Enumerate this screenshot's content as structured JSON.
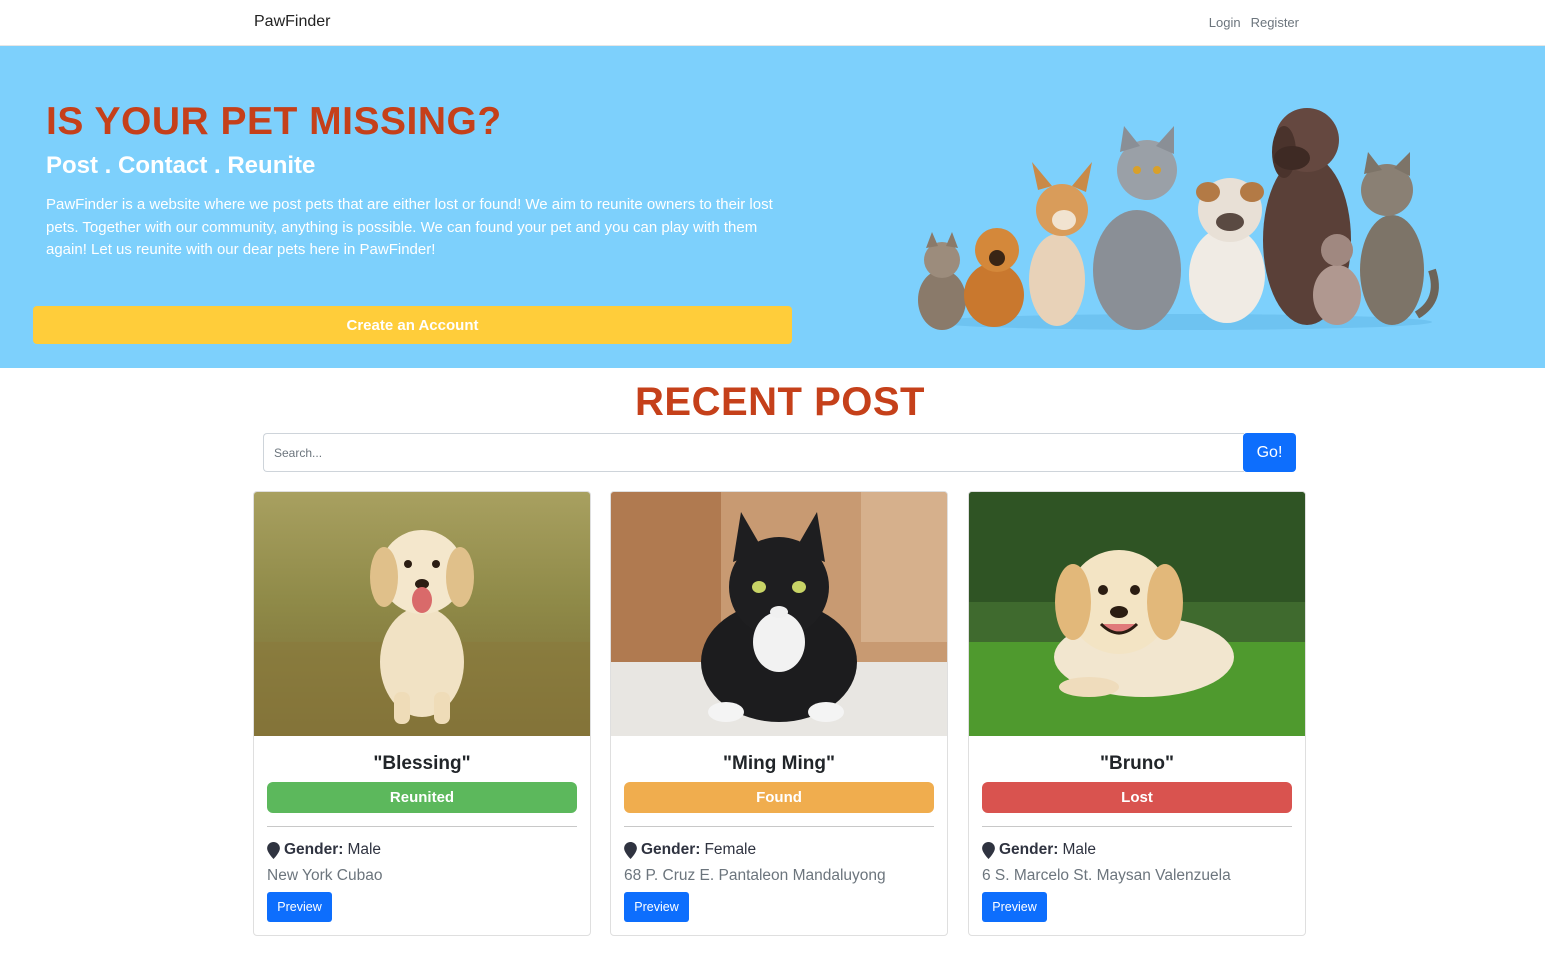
{
  "navbar": {
    "brand": "PawFinder",
    "links": [
      {
        "label": "Login"
      },
      {
        "label": "Register"
      }
    ]
  },
  "hero": {
    "title": "IS YOUR PET MISSING?",
    "subtitle": "Post . Contact . Reunite",
    "description": "PawFinder is a website where we post pets that are either lost or found! We aim to reunite owners to their lost pets. Together with our community, anything is possible. We can found your pet and you can play with them again! Let us reunite with our dear pets here in PawFinder!",
    "cta_label": "Create an Account"
  },
  "recent": {
    "title": "RECENT POST",
    "search_placeholder": "Search...",
    "search_button": "Go!"
  },
  "colors": {
    "hero_bg": "#7dd0fc",
    "accent_title": "#c5401a",
    "cta": "#ffcd3a",
    "primary": "#0d6efd",
    "reunited": "#5cb85c",
    "found": "#f0ad4e",
    "lost": "#d9534f"
  },
  "posts": [
    {
      "name": "\"Blessing\"",
      "status": "Reunited",
      "gender_label": "Gender:",
      "gender": "Male",
      "location": "New York Cubao",
      "preview": "Preview",
      "image": "golden-puppy-running"
    },
    {
      "name": "\"Ming Ming\"",
      "status": "Found",
      "gender_label": "Gender:",
      "gender": "Female",
      "location": "68 P. Cruz E. Pantaleon Mandaluyong",
      "preview": "Preview",
      "image": "black-white-cat"
    },
    {
      "name": "\"Bruno\"",
      "status": "Lost",
      "gender_label": "Gender:",
      "gender": "Male",
      "location": "6 S. Marcelo St. Maysan Valenzuela",
      "preview": "Preview",
      "image": "golden-puppy-lying"
    }
  ]
}
